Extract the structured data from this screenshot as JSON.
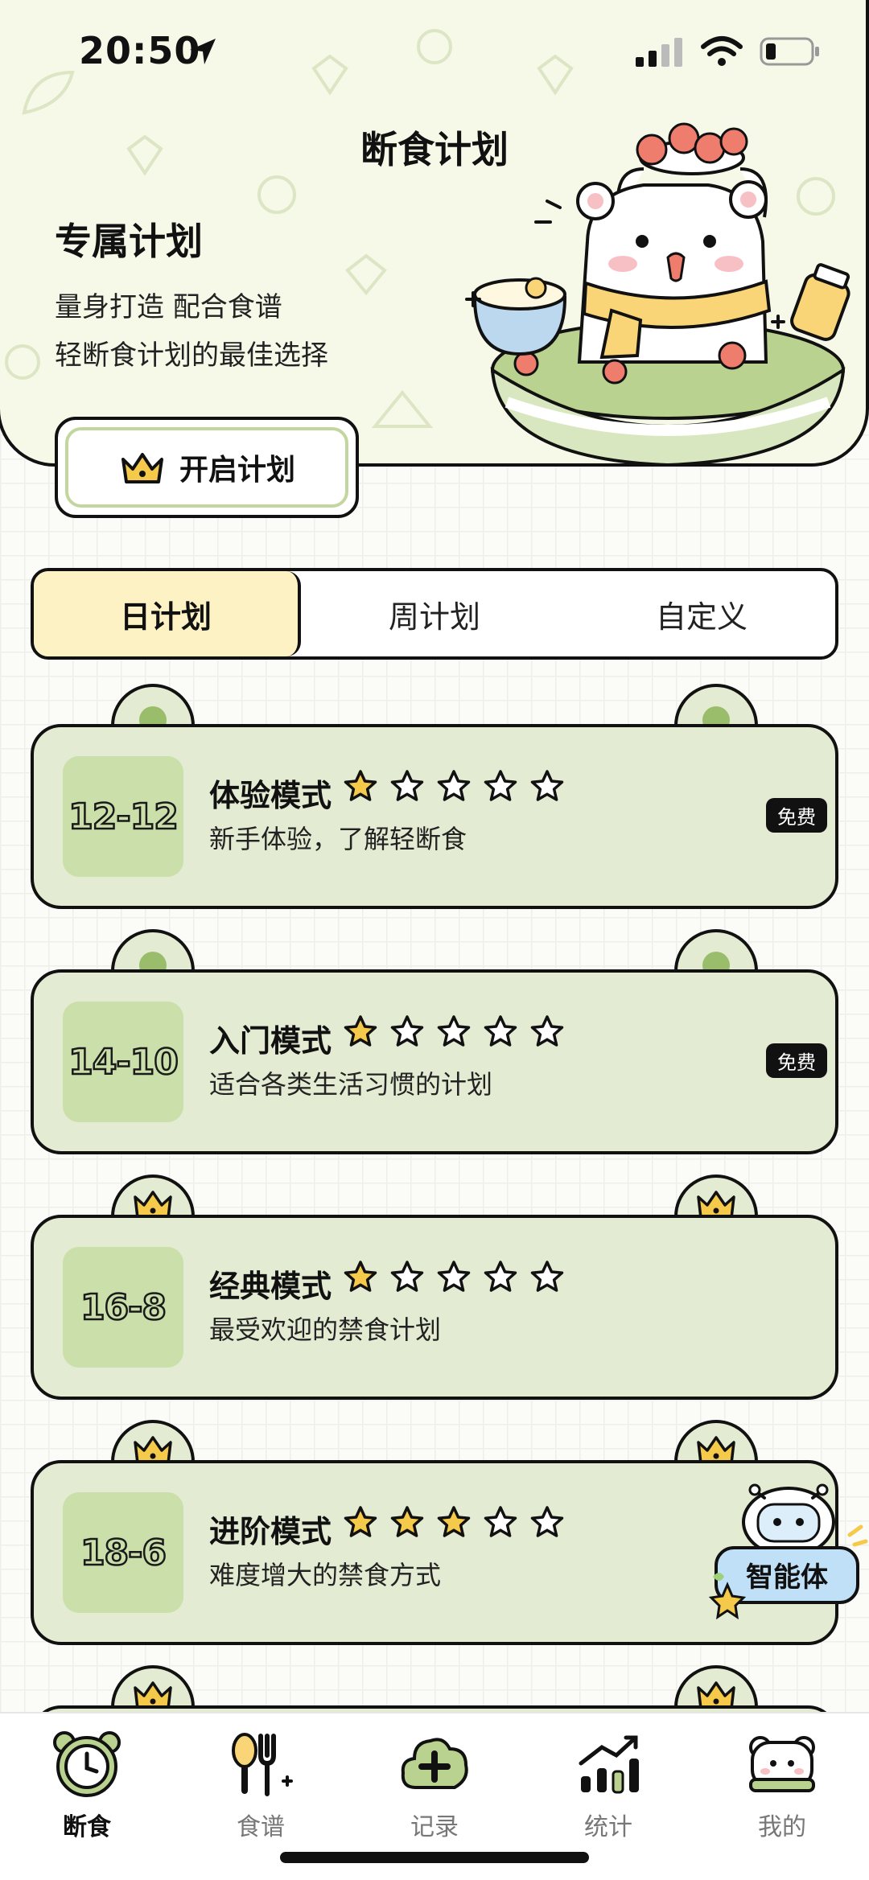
{
  "status_bar": {
    "time": "20:50"
  },
  "header": {
    "title": "断食计划",
    "plan_heading": "专属计划",
    "desc_line1": "量身打造 配合食谱",
    "desc_line2": "轻断食计划的最佳选择",
    "start_button": "开启计划"
  },
  "tabs": [
    {
      "label": "日计划",
      "active": true
    },
    {
      "label": "周计划",
      "active": false
    },
    {
      "label": "自定义",
      "active": false
    }
  ],
  "plans": [
    {
      "ratio": "12-12",
      "name": "体验模式",
      "stars": 1,
      "subtitle": "新手体验，了解轻断食",
      "badge": "免费",
      "locked": false
    },
    {
      "ratio": "14-10",
      "name": "入门模式",
      "stars": 1,
      "subtitle": "适合各类生活习惯的计划",
      "badge": "免费",
      "locked": false
    },
    {
      "ratio": "16-8",
      "name": "经典模式",
      "stars": 1,
      "subtitle": "最受欢迎的禁食计划",
      "badge": "",
      "locked": true
    },
    {
      "ratio": "18-6",
      "name": "进阶模式",
      "stars": 3,
      "subtitle": "难度增大的禁食方式",
      "badge": "",
      "locked": true
    }
  ],
  "agent_button": {
    "label": "智能体"
  },
  "bottom_nav": [
    {
      "label": "断食",
      "icon": "clock-icon",
      "active": true
    },
    {
      "label": "食谱",
      "icon": "fork-spoon-icon",
      "active": false
    },
    {
      "label": "记录",
      "icon": "plus-cloud-icon",
      "active": false
    },
    {
      "label": "统计",
      "icon": "chart-icon",
      "active": false
    },
    {
      "label": "我的",
      "icon": "bear-icon",
      "active": false
    }
  ],
  "colors": {
    "card_green": "#e3ecd2",
    "ratio_green": "#cbdfaa",
    "tab_active": "#fdf2c3",
    "star_gold": "#f5c94a",
    "header_bg": "#f6f8e8"
  }
}
